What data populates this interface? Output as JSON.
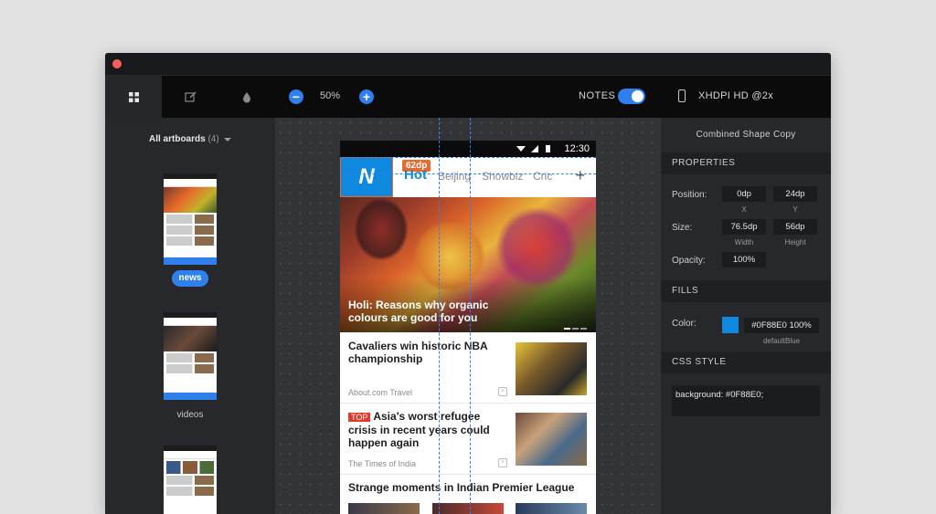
{
  "window": {
    "close_color": "#fc5f57"
  },
  "toolbar": {
    "tabs": [
      "artboards-grid",
      "edit-icon",
      "drop-icon"
    ],
    "zoom_out": "−",
    "zoom_value": "50%",
    "zoom_in": "+",
    "notes_label": "NOTES",
    "notes_enabled": true,
    "device_label": "XHDPI HD @2x"
  },
  "left_panel": {
    "heading": "All artboards",
    "count": "(4)",
    "artboards": [
      {
        "label": "news",
        "selected": true
      },
      {
        "label": "videos",
        "selected": false
      },
      {
        "label": "",
        "selected": false
      }
    ]
  },
  "phone": {
    "time": "12:30",
    "logo": "N",
    "measure_badge": "62dp",
    "tabs": [
      "Hot",
      "Beijing",
      "Showbiz",
      "Cric"
    ],
    "add": "+",
    "hero_caption": "Holi: Reasons why organic colours are good for you",
    "articles": [
      {
        "title": "Cavaliers win historic NBA championship",
        "source": "About.com Travel",
        "tag": ""
      },
      {
        "title": "Asia's worst refugee crisis in recent years could happen again",
        "source": "The Times of India",
        "tag": "TOP"
      },
      {
        "title": "Strange moments in Indian Premier League",
        "source": "",
        "tag": ""
      }
    ]
  },
  "right_panel": {
    "title": "Combined Shape Copy",
    "properties_heading": "PROPERTIES",
    "position_label": "Position:",
    "position_x": "0dp",
    "position_y": "24dp",
    "x_label": "X",
    "y_label": "Y",
    "size_label": "Size:",
    "size_w": "76.5dp",
    "size_h": "56dp",
    "w_label": "Width",
    "h_label": "Height",
    "opacity_label": "Opacity:",
    "opacity": "100%",
    "fills_heading": "FILLS",
    "color_label": "Color:",
    "color_value": "#0F88E0 100%",
    "color_name": "defaultBlue",
    "css_heading": "CSS STYLE",
    "css_value": "background: #0F88E0;"
  },
  "colors": {
    "accent": "#2f80ed",
    "brand_blue": "#0f88e0",
    "measure_orange": "#e96b2c"
  }
}
